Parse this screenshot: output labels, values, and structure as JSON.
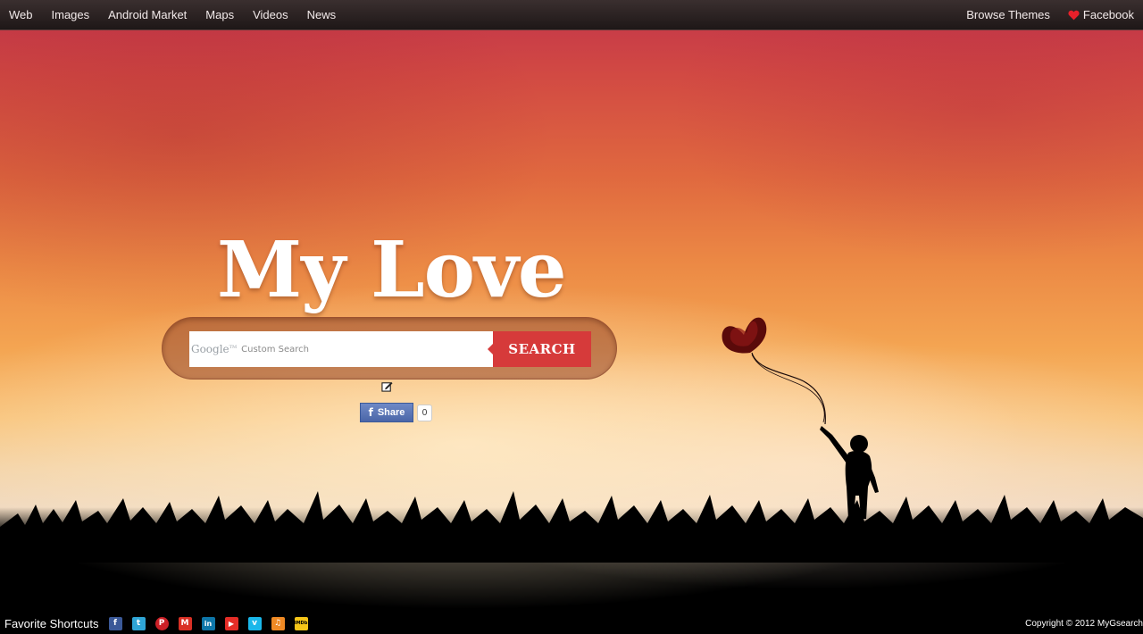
{
  "nav": {
    "left": [
      {
        "label": "Web"
      },
      {
        "label": "Images"
      },
      {
        "label": "Android Market"
      },
      {
        "label": "Maps"
      },
      {
        "label": "Videos"
      },
      {
        "label": "News"
      }
    ],
    "browse_themes": "Browse Themes",
    "facebook": "Facebook"
  },
  "title": "My Love",
  "search": {
    "placeholder": "Custom Search",
    "google_label": "Google",
    "tm": "TM",
    "button_label": "SEARCH"
  },
  "share": {
    "label": "Share",
    "icon_letter": "f",
    "count": "0"
  },
  "footer": {
    "shortcuts_label": "Favorite Shortcuts",
    "shortcuts": [
      {
        "name": "facebook-icon",
        "glyph": "f",
        "color": "#3b5998"
      },
      {
        "name": "twitter-icon",
        "glyph": "t",
        "color": "#2fa5d6"
      },
      {
        "name": "pinterest-icon",
        "glyph": "P",
        "color": "#cb2027"
      },
      {
        "name": "gmail-icon",
        "glyph": "M",
        "color": "#d93025"
      },
      {
        "name": "linkedin-icon",
        "glyph": "in",
        "color": "#0e76a8"
      },
      {
        "name": "youtube-icon",
        "glyph": "▶",
        "color": "#e52d27"
      },
      {
        "name": "vimeo-icon",
        "glyph": "v",
        "color": "#1ab7ea"
      },
      {
        "name": "music-icon",
        "glyph": "♫",
        "color": "#f08a24"
      },
      {
        "name": "imdb-icon",
        "glyph": "IMDb",
        "color": "#f5c518"
      }
    ],
    "copyright": "Copyright © 2012 MyGsearch"
  },
  "colors": {
    "accent_red": "#d63a3a",
    "facebook_blue": "#3b5998"
  }
}
